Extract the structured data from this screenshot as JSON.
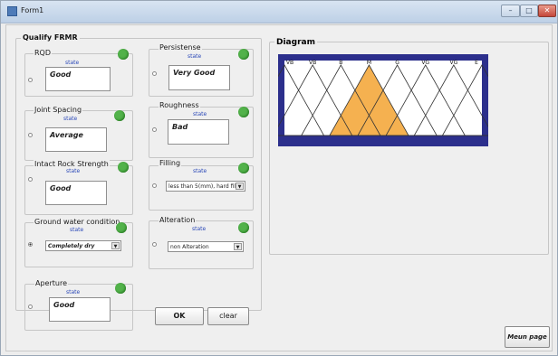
{
  "window": {
    "title": "Form1",
    "min_icon": "minimize-icon",
    "max_icon": "maximize-icon",
    "close_icon": "close-icon"
  },
  "main_group": {
    "title": "Qualify FRMR"
  },
  "state_text": "state",
  "params_left": [
    {
      "label": "RQD",
      "value": "Good"
    },
    {
      "label": "Joint Spacing",
      "value": "Average"
    },
    {
      "label": "Intact Rock Strength",
      "value": "Good"
    },
    {
      "label": "Ground water condition",
      "value": "Completely dry"
    },
    {
      "label": "Aperture",
      "value": "Good"
    }
  ],
  "params_right": [
    {
      "label": "Persistense",
      "value": "Very Good"
    },
    {
      "label": "Roughness",
      "value": "Bad"
    },
    {
      "label": "Filling",
      "value": "less than 5(mm), hard fill"
    },
    {
      "label": "Alteration",
      "value": "non Alteration"
    }
  ],
  "buttons": {
    "ok": "OK",
    "clear": "clear",
    "menu": "Meun page"
  },
  "diagram": {
    "title": "Diagram",
    "labels": [
      "VB",
      "VB",
      "B",
      "M",
      "G",
      "VG",
      "VG",
      "E"
    ],
    "highlighted_index": 3,
    "colors": {
      "border": "#2c2f8c",
      "highlight": "#f5b150",
      "line": "#333333"
    }
  }
}
